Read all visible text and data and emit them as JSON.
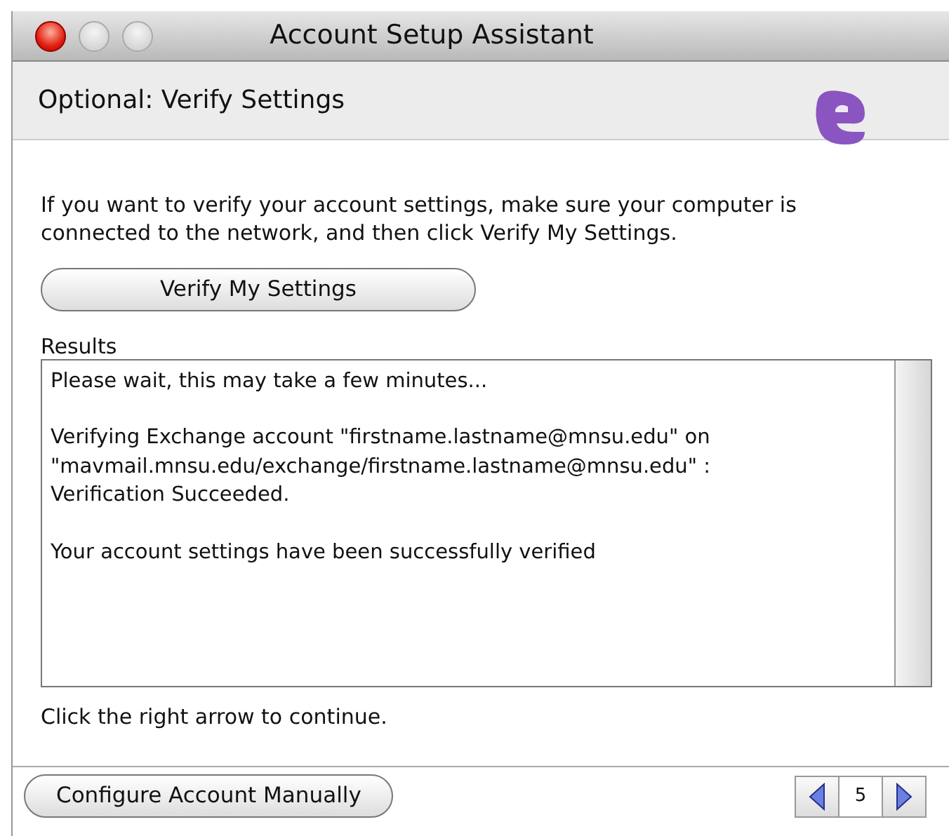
{
  "window": {
    "title": "Account Setup Assistant"
  },
  "header": {
    "title": "Optional: Verify Settings"
  },
  "intro": "If you want to verify your account settings, make sure your computer is connected to the network, and then click Verify My Settings.",
  "verify_button": "Verify My Settings",
  "results": {
    "label": "Results",
    "paragraphs": [
      [
        "Please wait, this may take a few minutes..."
      ],
      [
        "Verifying Exchange account \"firstname.lastname@mnsu.edu\" on",
        "\"mavmail.mnsu.edu/exchange/firstname.lastname@mnsu.edu\" :",
        "Verification Succeeded."
      ],
      [
        "Your account settings have been successfully verified"
      ]
    ]
  },
  "hint": "Click the right arrow to continue.",
  "footer": {
    "manual_button": "Configure Account Manually",
    "page": "5"
  }
}
